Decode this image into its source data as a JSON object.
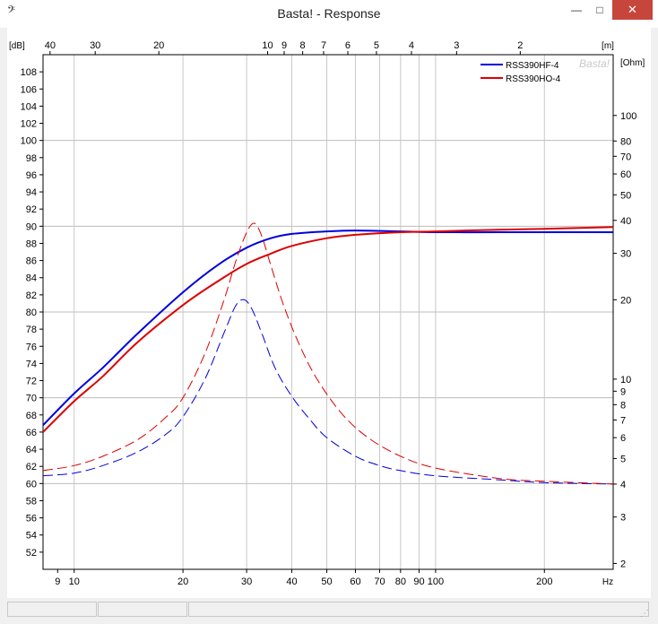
{
  "window": {
    "title": "Basta! - Response",
    "app_icon": "bass-clef-icon",
    "controls": {
      "minimize": "—",
      "maximize": "□",
      "close": "✕"
    }
  },
  "chart_data": {
    "type": "line",
    "watermark": "Basta!",
    "x_axis": {
      "label": "Hz",
      "scale": "log",
      "range": [
        8.2,
        310
      ],
      "ticks": [
        9,
        10,
        20,
        30,
        40,
        50,
        60,
        70,
        80,
        90,
        100,
        200
      ]
    },
    "top_axis": {
      "label": "[m]",
      "ticks": [
        40,
        30,
        20,
        10,
        9,
        8,
        7,
        6,
        5,
        4,
        3,
        2
      ]
    },
    "y_left": {
      "label": "[dB]",
      "range": [
        50,
        110
      ],
      "ticks": [
        52,
        54,
        56,
        58,
        60,
        62,
        64,
        66,
        68,
        70,
        72,
        74,
        76,
        78,
        80,
        82,
        84,
        86,
        88,
        90,
        92,
        94,
        96,
        98,
        100,
        102,
        104,
        106,
        108
      ]
    },
    "y_right": {
      "label": "[Ohm]",
      "scale": "log",
      "range": [
        1.9,
        170
      ],
      "ticks": [
        2,
        3,
        4,
        5,
        6,
        7,
        8,
        9,
        10,
        20,
        30,
        40,
        50,
        60,
        70,
        80,
        100
      ]
    },
    "grid": true,
    "legend_position": "top-right",
    "series": [
      {
        "name": "RSS390HF-4",
        "color": "#0000dd",
        "kind": "spl",
        "axis": "dB",
        "x": [
          8.2,
          10,
          12,
          15,
          20,
          25,
          30,
          35,
          40,
          50,
          60,
          80,
          100,
          150,
          200,
          310
        ],
        "y": [
          66.8,
          70.5,
          73.5,
          77.5,
          82.3,
          85.5,
          87.5,
          88.6,
          89.1,
          89.4,
          89.5,
          89.4,
          89.3,
          89.3,
          89.3,
          89.3
        ]
      },
      {
        "name": "RSS390HO-4",
        "color": "#dd0000",
        "kind": "spl",
        "axis": "dB",
        "x": [
          8.2,
          10,
          12,
          15,
          20,
          25,
          30,
          35,
          40,
          50,
          60,
          80,
          100,
          150,
          200,
          310
        ],
        "y": [
          66.0,
          69.6,
          72.5,
          76.5,
          80.8,
          83.6,
          85.6,
          86.8,
          87.7,
          88.6,
          89.0,
          89.3,
          89.4,
          89.6,
          89.7,
          89.9
        ]
      },
      {
        "name": "RSS390HF-4",
        "color": "#0000dd",
        "kind": "impedance",
        "axis": "Ohm",
        "x": [
          8.2,
          10,
          12,
          15,
          18,
          20,
          23,
          26,
          28,
          29.5,
          31,
          33,
          36,
          40,
          45,
          50,
          60,
          70,
          80,
          100,
          150,
          200,
          310
        ],
        "y": [
          4.3,
          4.4,
          4.7,
          5.3,
          6.2,
          7.2,
          10,
          15,
          19,
          20,
          18.5,
          15,
          11,
          8.6,
          7,
          6,
          5.1,
          4.7,
          4.5,
          4.3,
          4.15,
          4.05,
          4.0
        ]
      },
      {
        "name": "RSS390HO-4",
        "color": "#dd0000",
        "kind": "impedance",
        "axis": "Ohm",
        "x": [
          8.2,
          10,
          12,
          15,
          18,
          20,
          23,
          26,
          28,
          30,
          31.5,
          33,
          35,
          38,
          42,
          47,
          55,
          65,
          80,
          100,
          150,
          200,
          310
        ],
        "y": [
          4.5,
          4.7,
          5.1,
          5.9,
          7.2,
          8.5,
          12.5,
          20,
          28,
          36,
          39,
          35,
          27,
          19,
          13.5,
          10,
          7.4,
          6,
          5.1,
          4.6,
          4.2,
          4.1,
          4.0
        ]
      }
    ]
  }
}
